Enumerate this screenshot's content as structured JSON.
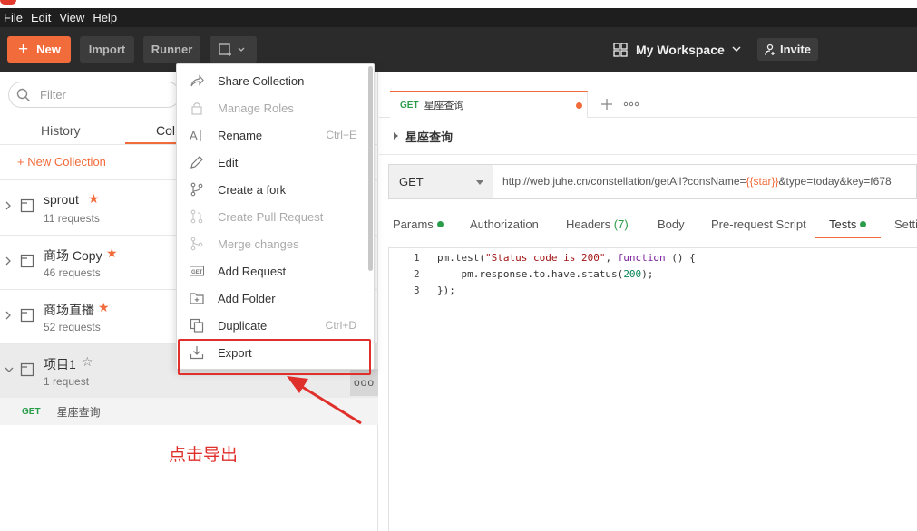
{
  "menu": [
    "File",
    "Edit",
    "View",
    "Help"
  ],
  "toolbar": {
    "new_label": "New",
    "import_label": "Import",
    "runner_label": "Runner",
    "workspace_label": "My Workspace",
    "invite_label": "Invite"
  },
  "sidebar": {
    "filter_placeholder": "Filter",
    "tab_history": "History",
    "tab_collections": "Col",
    "new_collection": "+ New Collection",
    "collections": [
      {
        "name": "sprout",
        "count": "11 requests",
        "starred": "★"
      },
      {
        "name": "商场 Copy",
        "count": "46 requests",
        "starred": "★"
      },
      {
        "name": "商场直播",
        "count": "52 requests",
        "starred": "★"
      },
      {
        "name": "项目1",
        "count": "1 request",
        "starred": "☆"
      }
    ],
    "more_dots": "ooo",
    "request": {
      "method": "GET",
      "name": "星座查询"
    }
  },
  "dropdown": {
    "items": [
      {
        "label": "Share Collection",
        "shortcut": "",
        "disabled": false,
        "icon": "share-icon"
      },
      {
        "label": "Manage Roles",
        "shortcut": "",
        "disabled": true,
        "icon": "lock-icon"
      },
      {
        "label": "Rename",
        "shortcut": "Ctrl+E",
        "disabled": false,
        "icon": "rename-icon"
      },
      {
        "label": "Edit",
        "shortcut": "",
        "disabled": false,
        "icon": "pencil-icon"
      },
      {
        "label": "Create a fork",
        "shortcut": "",
        "disabled": false,
        "icon": "fork-icon"
      },
      {
        "label": "Create Pull Request",
        "shortcut": "",
        "disabled": true,
        "icon": "pull-request-icon"
      },
      {
        "label": "Merge changes",
        "shortcut": "",
        "disabled": true,
        "icon": "merge-icon"
      },
      {
        "label": "Add Request",
        "shortcut": "",
        "disabled": false,
        "icon": "get-request-icon"
      },
      {
        "label": "Add Folder",
        "shortcut": "",
        "disabled": false,
        "icon": "folder-add-icon"
      },
      {
        "label": "Duplicate",
        "shortcut": "Ctrl+D",
        "disabled": false,
        "icon": "duplicate-icon"
      },
      {
        "label": "Export",
        "shortcut": "",
        "disabled": false,
        "icon": "export-icon"
      }
    ]
  },
  "annotation": {
    "text": "点击导出",
    "color": "#e0302b"
  },
  "main": {
    "tab_method": "GET",
    "tab_title": "星座查询",
    "request_name": "星座查询",
    "method": "GET",
    "url_prefix": "http://web.juhe.cn/constellation/getAll?consName=",
    "url_var": "{{star}}",
    "url_suffix": "&type=today&key=f678",
    "subtabs": {
      "params": "Params",
      "authorization": "Authorization",
      "headers": "Headers",
      "headers_count": "(7)",
      "body": "Body",
      "prerequest": "Pre-request Script",
      "tests": "Tests",
      "settings": "Setti"
    },
    "code_lines": [
      "1",
      "2",
      "3"
    ]
  },
  "colors": {
    "accent": "#f26b3a",
    "get_method": "#2a9d4b",
    "annotation_red": "#e0302b"
  }
}
